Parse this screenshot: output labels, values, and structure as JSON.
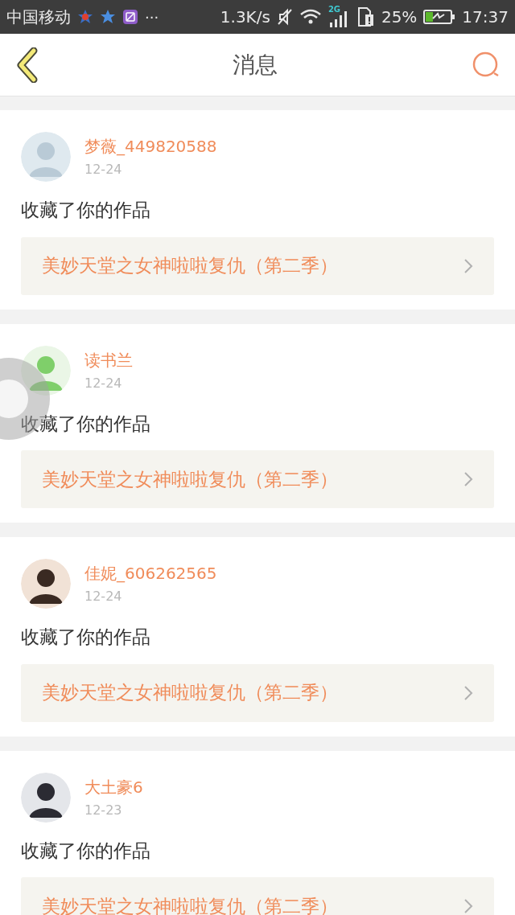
{
  "status_bar": {
    "carrier": "中国移动",
    "more": "···",
    "speed": "1.3K/s",
    "network": "2G",
    "battery": "25%",
    "time": "17:37"
  },
  "header": {
    "title": "消息"
  },
  "messages": [
    {
      "user": "梦薇_449820588",
      "date": "12-24",
      "action": "收藏了你的作品",
      "work": "美妙天堂之女神啦啦复仇（第二季）"
    },
    {
      "user": "读书兰",
      "date": "12-24",
      "action": "收藏了你的作品",
      "work": "美妙天堂之女神啦啦复仇（第二季）"
    },
    {
      "user": "佳妮_606262565",
      "date": "12-24",
      "action": "收藏了你的作品",
      "work": "美妙天堂之女神啦啦复仇（第二季）"
    },
    {
      "user": "大土豪6",
      "date": "12-23",
      "action": "收藏了你的作品",
      "work": "美妙天堂之女神啦啦复仇（第二季）"
    }
  ]
}
